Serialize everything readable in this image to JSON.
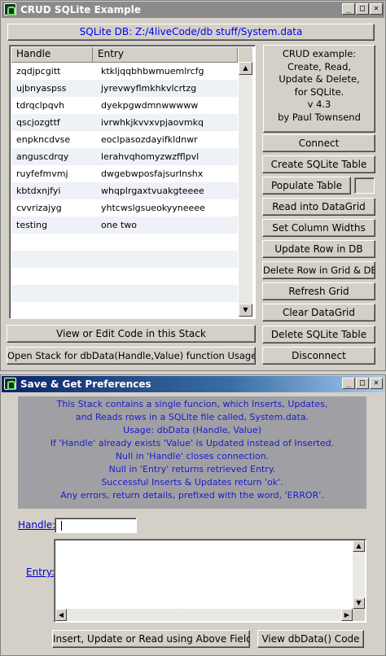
{
  "main_window": {
    "title": "CRUD SQLite Example",
    "controls": {
      "minimize": "_",
      "maximize": "□",
      "close": "✕"
    },
    "db_path": "SQLite DB: Z:/4liveCode/db stuff/System.data",
    "grid": {
      "columns": [
        "Handle",
        "Entry"
      ],
      "rows": [
        [
          "zqdjpcgitt",
          "ktkljqqbhbwmuemlrcfg"
        ],
        [
          "ujbnyaspss",
          "jyrevwyflmkhkvlcrtzg"
        ],
        [
          "tdrqclpqvh",
          "dyekpgwdmnwwwww"
        ],
        [
          "qscjozgttf",
          "ivrwhkjkvvxvpjaovmkq"
        ],
        [
          "enpkncdvse",
          "eoclpasozdayifkldnwr"
        ],
        [
          "anguscdrqy",
          "lerahvqhomyzwzfflpvl"
        ],
        [
          "ruyfefmvmj",
          "dwgebwposfajsurlnshx"
        ],
        [
          "kbtdxnjfyi",
          "whqplrgaxtvuakgteeee"
        ],
        [
          "cvvrizajyg",
          "yhtcwslgsueokyyneeee"
        ],
        [
          "testing",
          "one two"
        ]
      ]
    },
    "info_lines": [
      "CRUD example:",
      "Create, Read,",
      "Update & Delete,",
      "for SQLite.",
      "v 4.3",
      "by Paul Townsend"
    ],
    "buttons": {
      "connect": "Connect",
      "create_table": "Create SQLite Table",
      "populate_table": "Populate Table",
      "read_into_grid": "Read into DataGrid",
      "set_column_widths": "Set Column Widths",
      "update_row": "Update Row in DB",
      "delete_row": "Delete Row in Grid & DB",
      "refresh_grid": "Refresh Grid",
      "clear_grid": "Clear DataGrid",
      "delete_table": "Delete SQLite Table",
      "disconnect": "Disconnect",
      "view_code": "View or Edit Code in this Stack",
      "open_stack": "Open Stack for dbData(Handle,Value) function Usage"
    }
  },
  "prefs_window": {
    "title": "Save & Get Preferences",
    "controls": {
      "minimize": "_",
      "maximize": "□",
      "close": "✕"
    },
    "description_lines": [
      "This Stack contains a single funcion, which Inserts, Updates,",
      "and Reads rows in a SQLIte file called, System.data.",
      "Usage:  dbData (Handle, Value)",
      "If 'Handle' already exists 'Value' is Updated instead of Inserted.",
      "Null in 'Handle' closes connection.",
      "Null in 'Entry' returns retrieved Entry.",
      "Successful Inserts & Updates return 'ok'.",
      "Any errors, return details, prefixed with the word, 'ERROR'."
    ],
    "handle_label": "Handle:",
    "handle_value": "",
    "entry_label": "Entry:",
    "entry_value": "",
    "buttons": {
      "insert_update_read": "Insert, Update or Read using Above Fields",
      "view_dbdata_code": "View dbData() Code"
    }
  },
  "scrollbar_arrows": {
    "up": "▲",
    "down": "▼",
    "left": "◀",
    "right": "▶"
  }
}
